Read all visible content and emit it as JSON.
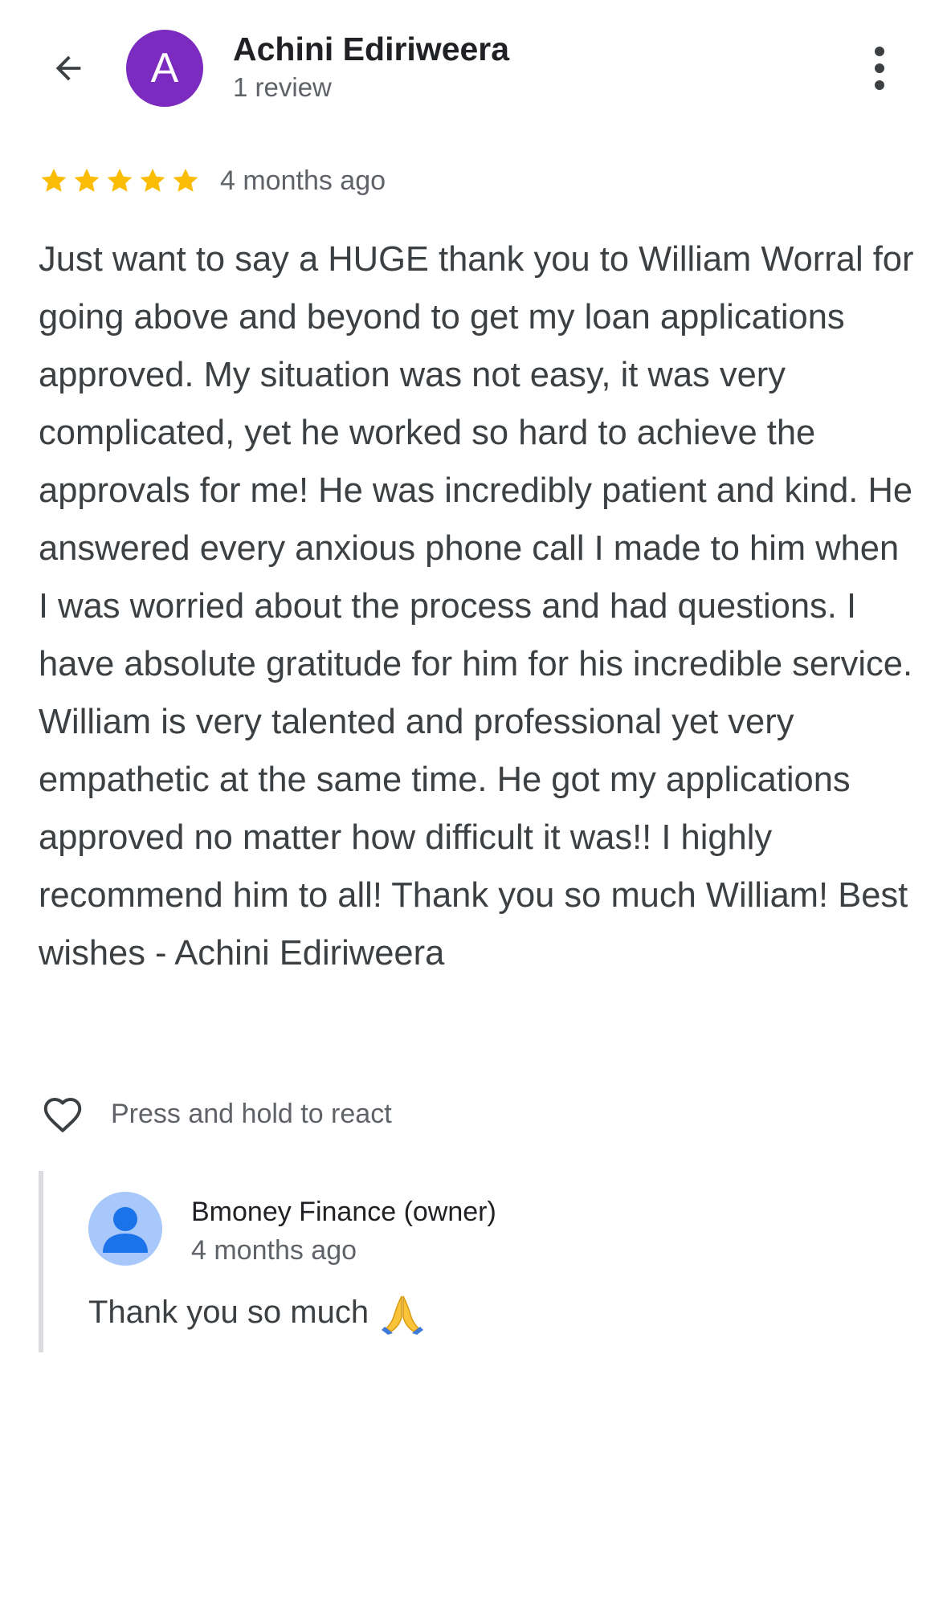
{
  "header": {
    "avatar_letter": "A",
    "avatar_color": "#7b2bbf",
    "reviewer_name": "Achini Ediriweera",
    "review_count": "1 review",
    "back_icon": "arrow-left-icon",
    "more_icon": "more-vertical-icon"
  },
  "review": {
    "rating": 5,
    "rating_max": 5,
    "star_color": "#fbbc04",
    "date": "4 months ago",
    "text": "Just want to say a HUGE thank you to William Worral for going above and beyond to get my loan applications approved. My situation was not easy, it was very complicated, yet he worked so hard to achieve the approvals for me! He was incredibly patient and kind. He answered every anxious phone call I made to him when I was worried about the process and had questions. I have absolute gratitude for him for his incredible service. William is very talented and professional yet very empathetic at the same time. He got my applications approved no matter how difficult it was!! I highly recommend him to all! Thank you so much William! Best wishes - Achini Ediriweera"
  },
  "react": {
    "icon": "heart-outline-icon",
    "hint": "Press and hold to react"
  },
  "owner_reply": {
    "avatar_icon": "person-icon",
    "name": "Bmoney Finance (owner)",
    "date": "4 months ago",
    "text": "Thank you so much",
    "emoji": "folded-hands-emoji"
  }
}
